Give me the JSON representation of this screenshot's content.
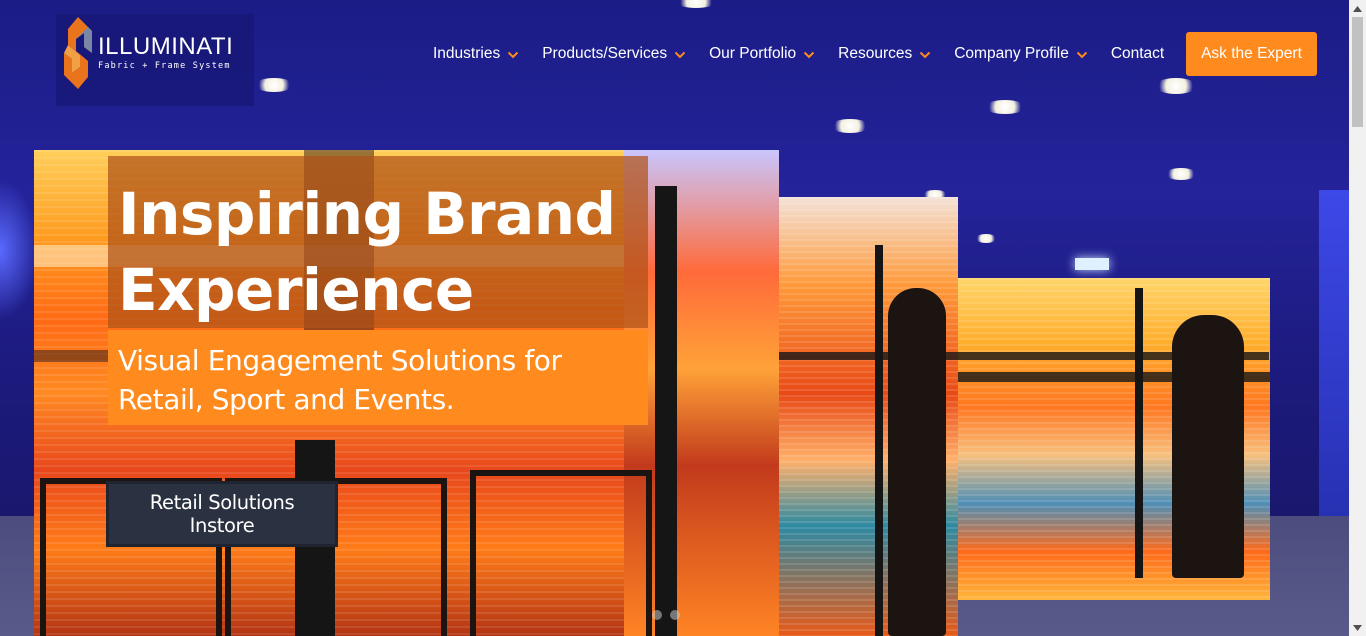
{
  "brand": {
    "name": "ILLUMINATI",
    "tagline": "Fabric + Frame System",
    "logo_icon": "illuminati-logo-icon"
  },
  "nav": {
    "items": [
      {
        "label": "Industries",
        "has_dropdown": true
      },
      {
        "label": "Products/Services",
        "has_dropdown": true
      },
      {
        "label": "Our Portfolio",
        "has_dropdown": true
      },
      {
        "label": "Resources",
        "has_dropdown": true
      },
      {
        "label": "Company Profile",
        "has_dropdown": true
      },
      {
        "label": "Contact",
        "has_dropdown": false
      }
    ],
    "dropdown_icon": "chevron-down-icon",
    "cta_label": "Ask the Expert"
  },
  "hero": {
    "headline_line1": "Inspiring Brand",
    "headline_line2": "Experience",
    "subhead_line1": "Visual Engagement Solutions for",
    "subhead_line2": "Retail, Sport and Events.",
    "button_label": "Retail Solutions Instore",
    "slider_dots": 2,
    "active_slide": 2
  },
  "colors": {
    "accent": "#ff8a1d",
    "headline_overlay": "#ae5218",
    "button_dark": "#2a3140",
    "nav_text": "#ffffff",
    "background_blue": "#1f1f8a"
  }
}
